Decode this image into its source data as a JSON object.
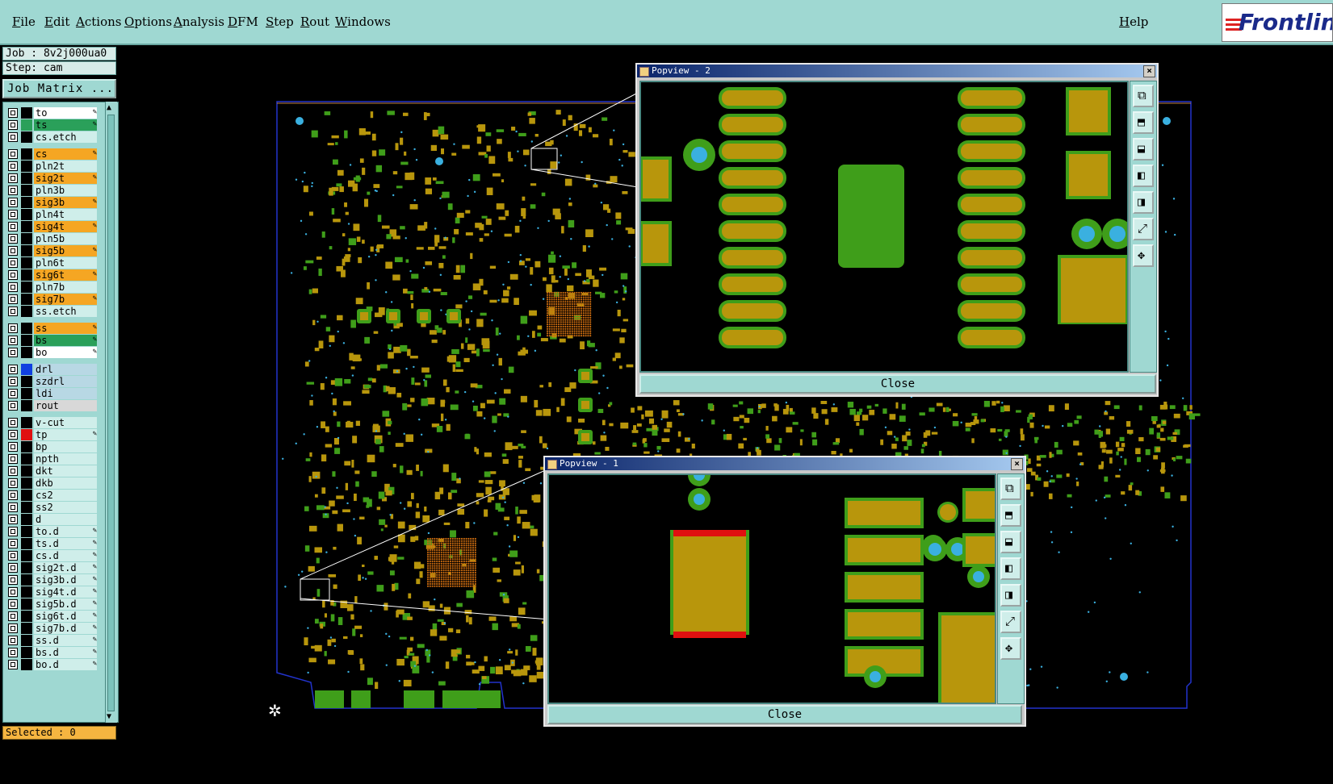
{
  "menu": {
    "items": [
      "File",
      "Edit",
      "Actions",
      "Options",
      "Analysis",
      "DFM",
      "Step",
      "Rout",
      "Windows"
    ],
    "help": "Help",
    "logo": "Frontline"
  },
  "info": {
    "job": "Job : 8v2j000ua0",
    "step": "Step: cam",
    "job_matrix": "Job Matrix ..."
  },
  "layers": [
    {
      "name": "to",
      "style": "white",
      "swatch": "#000",
      "pen": true
    },
    {
      "name": "ts",
      "style": "green",
      "swatch": "#2aa05a",
      "pen": true
    },
    {
      "name": "cs.etch",
      "style": "",
      "swatch": "#000",
      "pen": false
    },
    {
      "name": "cs",
      "style": "sig",
      "swatch": "#000",
      "pen": true
    },
    {
      "name": "pln2t",
      "style": "",
      "swatch": "#000",
      "pen": false
    },
    {
      "name": "sig2t",
      "style": "sig",
      "swatch": "#000",
      "pen": true
    },
    {
      "name": "pln3b",
      "style": "",
      "swatch": "#000",
      "pen": false
    },
    {
      "name": "sig3b",
      "style": "sig",
      "swatch": "#000",
      "pen": true
    },
    {
      "name": "pln4t",
      "style": "",
      "swatch": "#000",
      "pen": false
    },
    {
      "name": "sig4t",
      "style": "sig",
      "swatch": "#000",
      "pen": true
    },
    {
      "name": "pln5b",
      "style": "",
      "swatch": "#000",
      "pen": false
    },
    {
      "name": "sig5b",
      "style": "sig",
      "swatch": "#000",
      "pen": true
    },
    {
      "name": "pln6t",
      "style": "",
      "swatch": "#000",
      "pen": false
    },
    {
      "name": "sig6t",
      "style": "sig",
      "swatch": "#000",
      "pen": true
    },
    {
      "name": "pln7b",
      "style": "",
      "swatch": "#000",
      "pen": false
    },
    {
      "name": "sig7b",
      "style": "sig",
      "swatch": "#000",
      "pen": true
    },
    {
      "name": "ss.etch",
      "style": "",
      "swatch": "#000",
      "pen": false
    },
    {
      "name": "ss",
      "style": "sig",
      "swatch": "#000",
      "pen": true
    },
    {
      "name": "bs",
      "style": "green",
      "swatch": "#000",
      "pen": true
    },
    {
      "name": "bo",
      "style": "white",
      "swatch": "#000",
      "pen": true
    },
    {
      "name": "drl",
      "style": "drl",
      "swatch": "#1040e0",
      "pen": false
    },
    {
      "name": "szdrl",
      "style": "drl",
      "swatch": "#000",
      "pen": false
    },
    {
      "name": "ldi",
      "style": "drl",
      "swatch": "#000",
      "pen": false
    },
    {
      "name": "rout",
      "style": "gray",
      "swatch": "#000",
      "pen": false
    },
    {
      "name": "v-cut",
      "style": "",
      "swatch": "#000",
      "pen": false
    },
    {
      "name": "tp",
      "style": "",
      "swatch": "#e01010",
      "pen": true
    },
    {
      "name": "bp",
      "style": "",
      "swatch": "#000",
      "pen": false
    },
    {
      "name": "npth",
      "style": "",
      "swatch": "#000",
      "pen": false
    },
    {
      "name": "dkt",
      "style": "",
      "swatch": "#000",
      "pen": false
    },
    {
      "name": "dkb",
      "style": "",
      "swatch": "#000",
      "pen": false
    },
    {
      "name": "cs2",
      "style": "",
      "swatch": "#000",
      "pen": false
    },
    {
      "name": "ss2",
      "style": "",
      "swatch": "#000",
      "pen": false
    },
    {
      "name": "d",
      "style": "",
      "swatch": "#000",
      "pen": false
    },
    {
      "name": "to.d",
      "style": "",
      "swatch": "#000",
      "pen": true
    },
    {
      "name": "ts.d",
      "style": "",
      "swatch": "#000",
      "pen": true
    },
    {
      "name": "cs.d",
      "style": "",
      "swatch": "#000",
      "pen": true
    },
    {
      "name": "sig2t.d",
      "style": "",
      "swatch": "#000",
      "pen": true
    },
    {
      "name": "sig3b.d",
      "style": "",
      "swatch": "#000",
      "pen": true
    },
    {
      "name": "sig4t.d",
      "style": "",
      "swatch": "#000",
      "pen": true
    },
    {
      "name": "sig5b.d",
      "style": "",
      "swatch": "#000",
      "pen": true
    },
    {
      "name": "sig6t.d",
      "style": "",
      "swatch": "#000",
      "pen": true
    },
    {
      "name": "sig7b.d",
      "style": "",
      "swatch": "#000",
      "pen": true
    },
    {
      "name": "ss.d",
      "style": "",
      "swatch": "#000",
      "pen": true
    },
    {
      "name": "bs.d",
      "style": "",
      "swatch": "#000",
      "pen": true
    },
    {
      "name": "bo.d",
      "style": "",
      "swatch": "#000",
      "pen": true
    }
  ],
  "status": {
    "selected": "Selected : 0"
  },
  "popview2": {
    "title": "Popview - 2",
    "close_label": "Close"
  },
  "popview1": {
    "title": "Popview - 1",
    "close_label": "Close"
  },
  "colors": {
    "pad": "#b8960c",
    "mask": "#3f9e1a",
    "drill": "#3ab0e0",
    "outline": "#2233cc",
    "accent_menu": "#9fd8d2",
    "paste_red": "#e01010"
  },
  "tool_icons": [
    "popup-window-icon",
    "move-up-icon",
    "move-down-icon",
    "move-left-icon",
    "move-right-icon",
    "zoom-fit-icon",
    "pan-center-icon"
  ]
}
